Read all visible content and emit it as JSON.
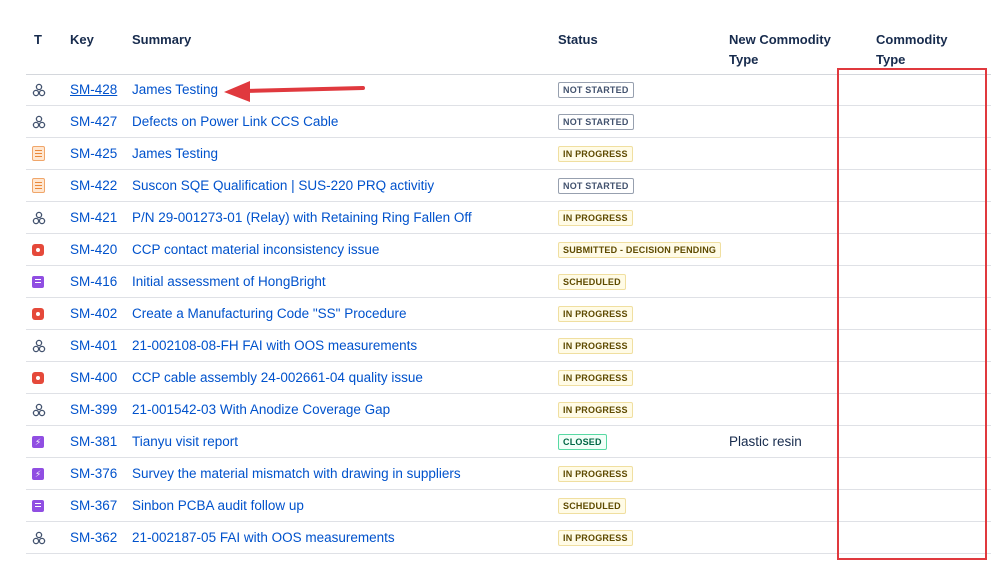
{
  "headers": {
    "type": "T",
    "key": "Key",
    "summary": "Summary",
    "status": "Status",
    "new_commodity_type_line1": "New Commodity",
    "new_commodity_type_line2": "Type",
    "commodity_type_line1": "Commodity",
    "commodity_type_line2": "Type"
  },
  "rows": [
    {
      "icon": "subtask-icon",
      "key": "SM-428",
      "summary": "James Testing",
      "status": "NOT STARTED",
      "new_commodity": ""
    },
    {
      "icon": "subtask-icon",
      "key": "SM-427",
      "summary": "Defects on Power Link CCS Cable",
      "status": "NOT STARTED",
      "new_commodity": ""
    },
    {
      "icon": "document-icon",
      "key": "SM-425",
      "summary": "James Testing",
      "status": "IN PROGRESS",
      "new_commodity": ""
    },
    {
      "icon": "document-icon",
      "key": "SM-422",
      "summary": "Suscon SQE Qualification | SUS-220 PRQ activitiy",
      "status": "NOT STARTED",
      "new_commodity": ""
    },
    {
      "icon": "subtask-icon",
      "key": "SM-421",
      "summary": "P/N 29-001273-01 (Relay) with Retaining Ring Fallen Off",
      "status": "IN PROGRESS",
      "new_commodity": ""
    },
    {
      "icon": "bug-icon",
      "key": "SM-420",
      "summary": "CCP contact material inconsistency issue",
      "status": "SUBMITTED - DECISION PENDING",
      "new_commodity": ""
    },
    {
      "icon": "note-icon",
      "key": "SM-416",
      "summary": "Initial assessment of HongBright",
      "status": "SCHEDULED",
      "new_commodity": ""
    },
    {
      "icon": "bug-icon",
      "key": "SM-402",
      "summary": "Create a Manufacturing Code \"SS\" Procedure",
      "status": "IN PROGRESS",
      "new_commodity": ""
    },
    {
      "icon": "subtask-icon",
      "key": "SM-401",
      "summary": "21-002108-08-FH FAI with OOS measurements",
      "status": "IN PROGRESS",
      "new_commodity": ""
    },
    {
      "icon": "bug-icon",
      "key": "SM-400",
      "summary": "CCP cable assembly 24-002661-04 quality issue",
      "status": "IN PROGRESS",
      "new_commodity": ""
    },
    {
      "icon": "subtask-icon",
      "key": "SM-399",
      "summary": "21-001542-03 With Anodize Coverage Gap",
      "status": "IN PROGRESS",
      "new_commodity": ""
    },
    {
      "icon": "bolt-icon",
      "key": "SM-381",
      "summary": "Tianyu visit report",
      "status": "CLOSED",
      "new_commodity": "Plastic resin"
    },
    {
      "icon": "bolt-icon",
      "key": "SM-376",
      "summary": "Survey the material mismatch with drawing in suppliers",
      "status": "IN PROGRESS",
      "new_commodity": ""
    },
    {
      "icon": "note-icon",
      "key": "SM-367",
      "summary": "Sinbon PCBA audit follow up",
      "status": "SCHEDULED",
      "new_commodity": ""
    },
    {
      "icon": "subtask-icon",
      "key": "SM-362",
      "summary": "21-002187-05 FAI with OOS measurements",
      "status": "IN PROGRESS",
      "new_commodity": ""
    }
  ],
  "colors": {
    "link": "#0052cc",
    "annotation_red": "#e0393e"
  }
}
